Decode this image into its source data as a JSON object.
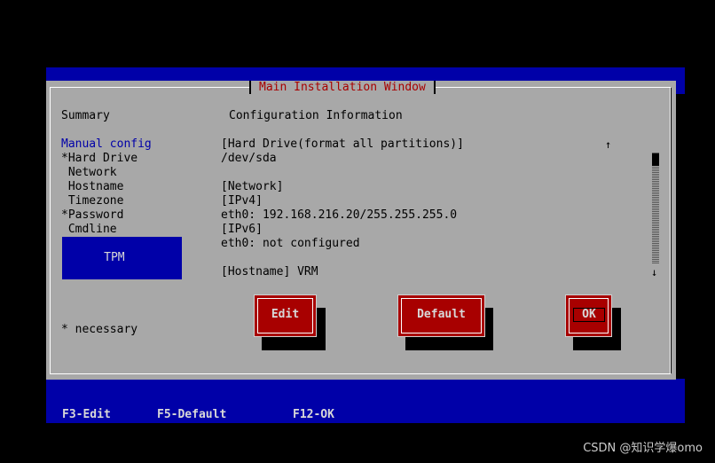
{
  "window": {
    "title": "Main Installation Window",
    "summary_header": "Summary",
    "config_header": "Configuration Information"
  },
  "menu": {
    "items": [
      {
        "label": "Manual config"
      },
      {
        "label": "*Hard Drive"
      },
      {
        "label": " Network"
      },
      {
        "label": " Hostname"
      },
      {
        "label": " Timezone"
      },
      {
        "label": "*Password"
      },
      {
        "label": " Cmdline"
      },
      {
        "label": " TPM"
      }
    ],
    "footnote": "* necessary"
  },
  "config": {
    "lines": [
      "[Hard Drive(format all partitions)]",
      "/dev/sda",
      "",
      "[Network]",
      "[IPv4]",
      "eth0: 192.168.216.20/255.255.255.0",
      "[IPv6]",
      "eth0: not configured",
      "",
      "[Hostname] VRM"
    ]
  },
  "scrollbar": {
    "up": "↑",
    "down": "↓"
  },
  "buttons": {
    "edit": "Edit",
    "default": "Default",
    "ok": "OK"
  },
  "footer": {
    "f3": "F3-Edit",
    "f5": "F5-Default",
    "f12": "F12-OK"
  },
  "watermark": "CSDN @知识学爆omo",
  "colors": {
    "screen": "#000000",
    "band": "#0000a8",
    "window": "#a8a8a8",
    "accent": "#a80000",
    "selection": "#0000a8"
  }
}
